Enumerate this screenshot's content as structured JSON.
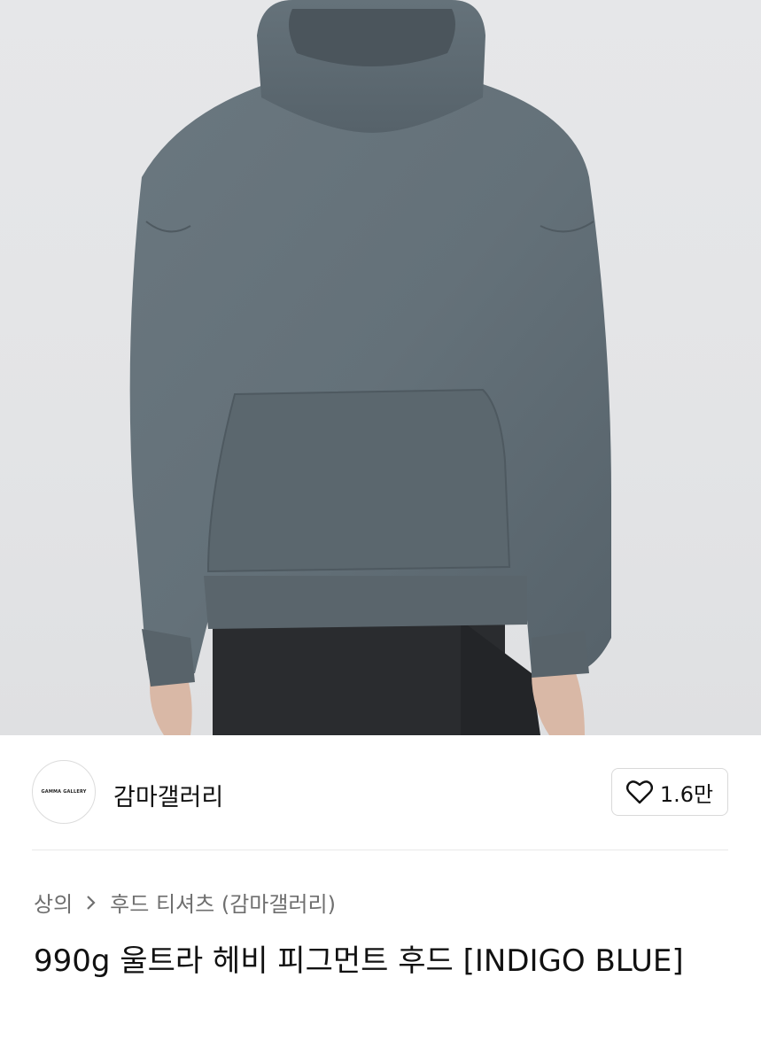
{
  "brand": {
    "logo_text": "GAMMA GALLERY",
    "name": "감마갤러리"
  },
  "like": {
    "icon": "heart-icon",
    "count": "1.6만"
  },
  "breadcrumb": {
    "items": [
      "상의",
      "후드 티셔츠 (감마갤러리)"
    ],
    "separator_icon": "chevron-right-icon"
  },
  "product": {
    "title": "990g 울트라 헤비 피그먼트 후드 [INDIGO BLUE]"
  },
  "colors": {
    "hoodie": "#5f6b72",
    "background": "#e4e5e7",
    "text": "#111111",
    "muted_text": "#6f6f6f"
  }
}
